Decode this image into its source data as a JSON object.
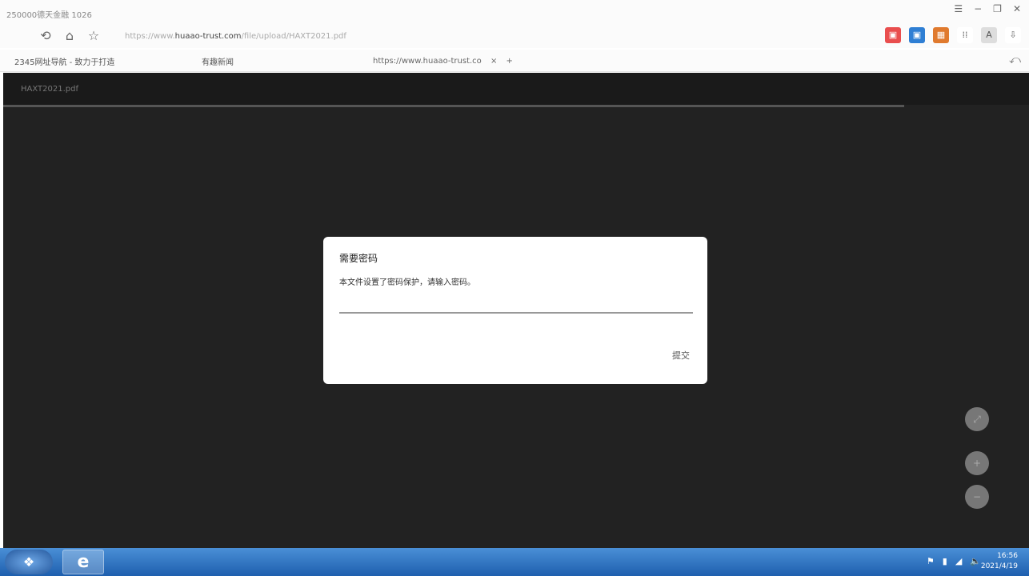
{
  "window": {
    "title": "250000德天金融 1026"
  },
  "nav": {
    "url_prefix": "https://www.",
    "url_host": "huaao-trust.com",
    "url_path": "/file/upload/HAXT2021.pdf",
    "back": "⟲",
    "home": "⌂",
    "star": "☆"
  },
  "bookmarks": {
    "first": "2345网址导航 - 致力于打造",
    "second": "有趣新闻",
    "tab_title": "https://www.huaao-trust.co",
    "tab_close": "×",
    "tab_add": "+"
  },
  "viewer": {
    "filename": "HAXT2021.pdf"
  },
  "dialog": {
    "title": "需要密码",
    "message": "本文件设置了密码保护，请输入密码。",
    "submit_label": "提交"
  },
  "taskbar": {
    "time": "16:56",
    "date": "2021/4/19"
  },
  "colors": {
    "viewer_bg": "#222222",
    "dialog_bg": "#ffffff",
    "taskbar": "#2a6cc0"
  }
}
